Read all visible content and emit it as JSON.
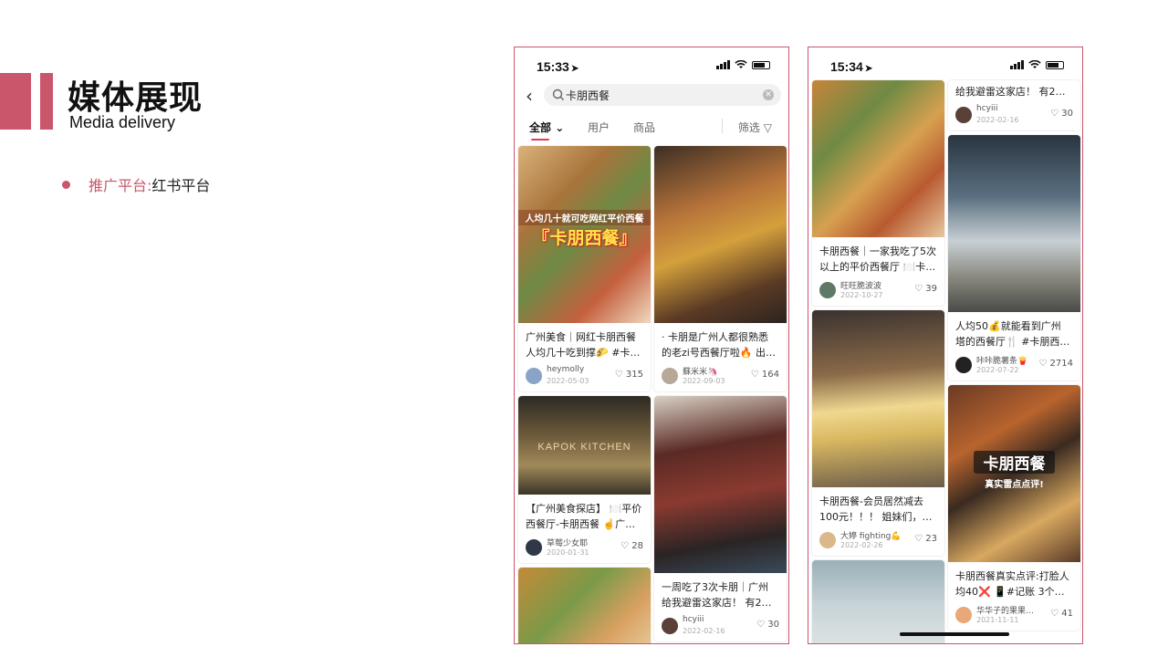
{
  "slide": {
    "title": "媒体展现",
    "subtitle": "Media delivery",
    "bullet_label": "推广平台:",
    "bullet_value": "红书平台"
  },
  "colors": {
    "accent": "#c9566b",
    "tab_underline": "#e23b4f"
  },
  "phone_left": {
    "time": "15:33",
    "search_query": "卡朋西餐",
    "tabs": [
      "全部",
      "用户",
      "商品"
    ],
    "filter_label": "筛选",
    "icons": [
      "back-arrow-icon",
      "search-icon",
      "clear-icon",
      "chevron-down-icon",
      "filter-icon"
    ],
    "cards_col1": [
      {
        "image_text": "人均几十就可吃网红平价西餐",
        "image_title": "『卡朋西餐』",
        "caption": "广州美食｜网红卡朋西餐 人均几十吃到撑🌮 #卡…",
        "user": "heymolly",
        "date": "2022-05-03",
        "likes": "315",
        "avatar": "#8aa4c8"
      },
      {
        "image_text": "KAPOK KITCHEN",
        "caption": "【广州美食探店】 🍽️平价 西餐厅-卡朋西餐 ☝️广…",
        "user": "草莓少女耶",
        "date": "2020-01-31",
        "likes": "28",
        "avatar": "#303848"
      },
      {
        "image_text": "",
        "caption": "",
        "user": "",
        "date": "",
        "likes": "",
        "avatar": "#999"
      }
    ],
    "cards_col2": [
      {
        "image_text": "",
        "caption": "· 卡朋是广州人都很熟悉 的老zi号西餐厅啦🔥 出…",
        "user": "蘇米米🦄",
        "date": "2022-09-03",
        "likes": "164",
        "avatar": "#b8a898"
      },
      {
        "image_text": "",
        "caption": "一周吃了3次卡朋｜广州 给我避雷这家店！ 有2…",
        "user": "hcyiii",
        "date": "2022-02-16",
        "likes": "30",
        "avatar": "#5a4038"
      }
    ]
  },
  "phone_right": {
    "time": "15:34",
    "cards_col1": [
      {
        "caption": "卡朋西餐｜一家我吃了5次 以上的平价西餐厅 🍽️卡…",
        "user": "旺旺脆波波",
        "date": "2022-10-27",
        "likes": "39",
        "avatar": "#5e7a66"
      },
      {
        "caption": "卡朋西餐-会员居然减去 100元！！！ 姐妹们，…",
        "user": "大婷 fighting💪",
        "date": "2022-02-26",
        "likes": "23",
        "avatar": "#d9b98a"
      },
      {
        "caption": "",
        "user": "",
        "date": "",
        "likes": "",
        "avatar": "#999"
      }
    ],
    "cards_col2": [
      {
        "caption": "给我避雷这家店！ 有2…",
        "user": "hcyiii",
        "date": "2022-02-16",
        "likes": "30",
        "avatar": "#5a4038"
      },
      {
        "caption": "人均50💰就能看到广州 塔的西餐厅🍴 #卡朋西…",
        "user": "咔咔脆薯条🍟",
        "date": "2022-07-22",
        "likes": "2714",
        "avatar": "#222"
      },
      {
        "image_title": "卡朋西餐",
        "image_text": "真实雷点点评!",
        "caption": "卡朋西餐真实点评:打脸人 均40❌ 📱#记账 3个…",
        "user": "华华子的果果…",
        "date": "2021-11-11",
        "likes": "41",
        "avatar": "#e8a878"
      }
    ]
  }
}
